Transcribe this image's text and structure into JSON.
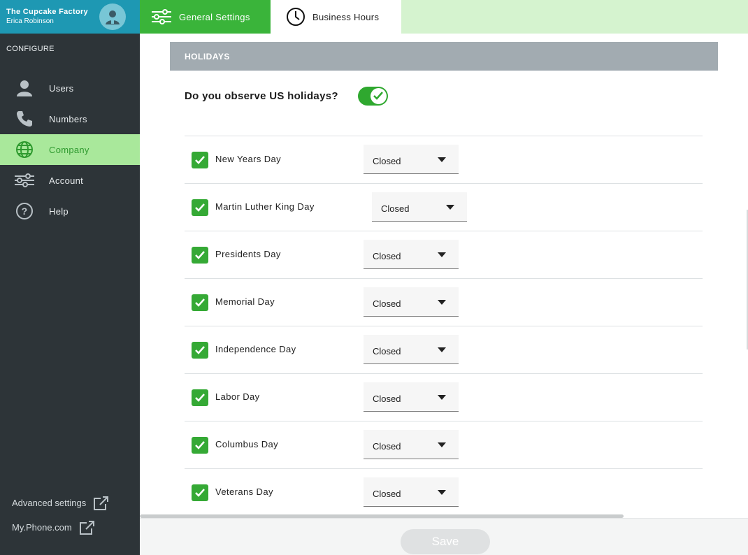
{
  "sidebar": {
    "brand_name": "The Cupcake Factory",
    "user_name": "Erica Robinson",
    "section_label": "CONFIGURE",
    "items": [
      {
        "label": "Users",
        "icon": "user-icon",
        "active": false
      },
      {
        "label": "Numbers",
        "icon": "phone-icon",
        "active": false
      },
      {
        "label": "Company",
        "icon": "globe-icon",
        "active": true
      },
      {
        "label": "Account",
        "icon": "sliders-icon",
        "active": false
      },
      {
        "label": "Help",
        "icon": "help-icon",
        "active": false
      }
    ],
    "footer_links": [
      {
        "label": "Advanced settings",
        "icon": "external-link-icon"
      },
      {
        "label": "My.Phone.com",
        "icon": "external-link-icon"
      }
    ]
  },
  "tabs": [
    {
      "label": "General Settings",
      "icon": "sliders-icon",
      "active": false
    },
    {
      "label": "Business Hours",
      "icon": "clock-icon",
      "active": true
    }
  ],
  "holidays": {
    "section_title": "HOLIDAYS",
    "question": "Do you observe US holidays?",
    "observe": true,
    "rows": [
      {
        "name": "New Years Day",
        "checked": true,
        "status": "Closed"
      },
      {
        "name": "Martin Luther King Day",
        "checked": true,
        "status": "Closed"
      },
      {
        "name": "Presidents Day",
        "checked": true,
        "status": "Closed"
      },
      {
        "name": "Memorial Day",
        "checked": true,
        "status": "Closed"
      },
      {
        "name": "Independence Day",
        "checked": true,
        "status": "Closed"
      },
      {
        "name": "Labor Day",
        "checked": true,
        "status": "Closed"
      },
      {
        "name": "Columbus Day",
        "checked": true,
        "status": "Closed"
      },
      {
        "name": "Veterans Day",
        "checked": true,
        "status": "Closed"
      }
    ]
  },
  "footer": {
    "save_label": "Save"
  },
  "colors": {
    "brand": "#1e98b3",
    "accent_green": "#3ab43a",
    "sidebar_bg": "#2d3438",
    "active_nav": "#a9e89b"
  }
}
